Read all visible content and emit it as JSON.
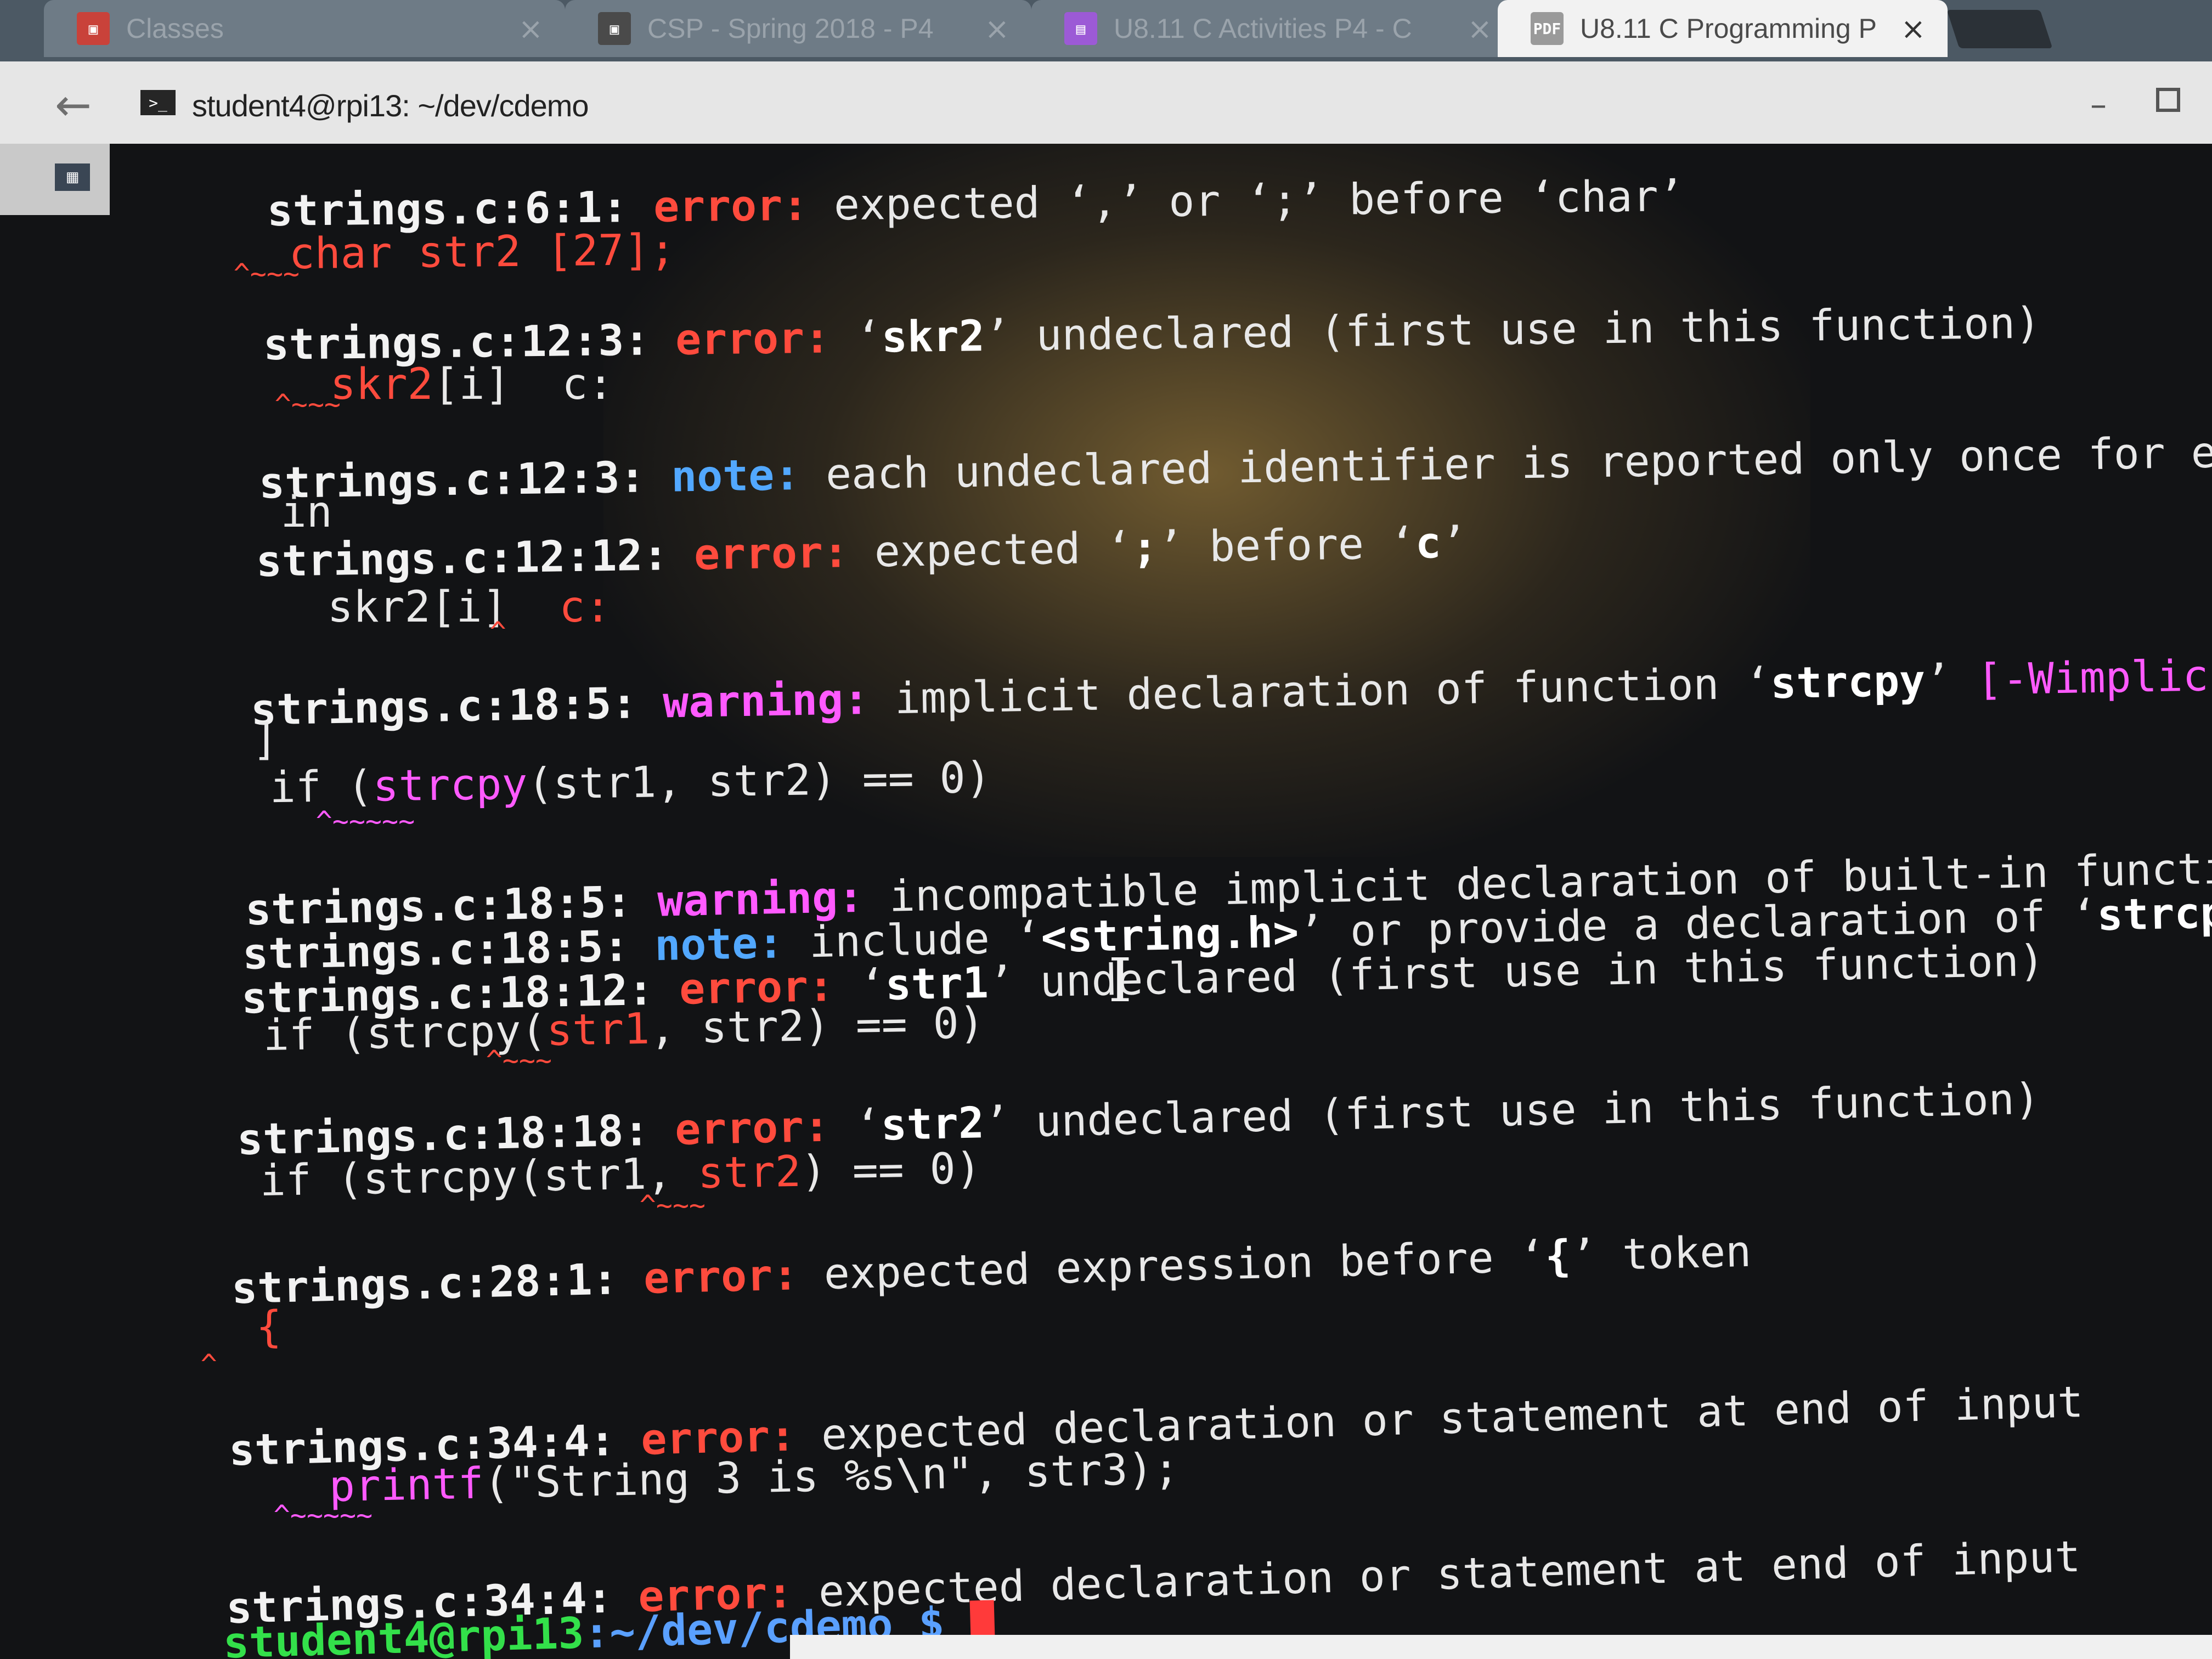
{
  "browser": {
    "tabs": [
      {
        "title": "Classes",
        "favicon": "classroom-icon",
        "favicon_color": "#c9423a",
        "active": false
      },
      {
        "title": "CSP - Spring 2018 - P4",
        "favicon": "classroom-icon",
        "favicon_color": "#4a4a4a",
        "active": false
      },
      {
        "title": "U8.11 C Activities P4 - C",
        "favicon": "slides-icon",
        "favicon_color": "#9c5ad6",
        "active": false
      },
      {
        "title": "U8.11 C Programming P",
        "favicon": "pdf-icon",
        "favicon_color": "#9a9a9a",
        "active": true
      }
    ],
    "tab_close_glyph": "×",
    "pdf_favicon_text": "PDF"
  },
  "window": {
    "title": "student4@rpi13: ~/dev/cdemo",
    "terminal_icon_text": ">_"
  },
  "terminal": {
    "lines": {
      "l1_loc": "strings.c:6:1:",
      "l1_kind": "error:",
      "l1_msg": "expected ‘,’ or ‘;’ before ‘char’",
      "l2_src": "char str2 [27];",
      "l3_caret": "^~~~",
      "l4_loc": "strings.c:12:3:",
      "l4_kind": "error:",
      "l4_msg_a": "‘",
      "l4_ident": "skr2",
      "l4_msg_b": "’ undeclared (first use in this function)",
      "l5_src_a": "skr2",
      "l5_src_b": "[i]  c:",
      "l6_caret": "^~~~",
      "l7_loc": "strings.c:12:3:",
      "l7_kind": "note:",
      "l7_msg": "each undeclared identifier is reported only once for each function it ap",
      "l8_wrap": "in",
      "l9_loc": "strings.c:12:12:",
      "l9_kind": "error:",
      "l9_msg_a": "expected ‘",
      "l9_ident_a": ";",
      "l9_msg_b": "’ before ‘",
      "l9_ident_b": "c",
      "l9_msg_c": "’",
      "l10_src_a": "skr2[i]  ",
      "l10_src_b": "c:",
      "l11_caret": "^",
      "l12_loc": "strings.c:18:5:",
      "l12_kind": "warning:",
      "l12_msg_a": "implicit declaration of function ‘",
      "l12_ident": "strcpy",
      "l12_msg_b": "’ ",
      "l12_flag": "[-Wimplicit-function-decla",
      "l13_wrap": "]",
      "l14_src_a": "if (",
      "l14_src_b": "strcpy",
      "l14_src_c": "(str1, str2) == 0)",
      "l15_caret": "^~~~~~",
      "l16_loc": "strings.c:18:5:",
      "l16_kind": "warning:",
      "l16_msg": "incompatible implicit declaration of built-in function ‘strcpy’",
      "l17_loc": "strings.c:18:5:",
      "l17_kind": "note:",
      "l17_msg_a": "include ‘",
      "l17_ident": "<string.h>",
      "l17_msg_b": "’ or provide a declaration of ‘",
      "l17_ident_b": "strcpy",
      "l17_msg_c": "’",
      "l18_loc": "strings.c:18:12:",
      "l18_kind": "error:",
      "l18_msg_a": "‘",
      "l18_ident": "str1",
      "l18_msg_b": "’ undeclared (first use in this function)",
      "l19_src_a": "if (strcpy(",
      "l19_src_b": "str1",
      "l19_src_c": ", str2) == 0)",
      "l20_caret": "^~~~",
      "l21_loc": "strings.c:18:18:",
      "l21_kind": "error:",
      "l21_msg_a": "‘",
      "l21_ident": "str2",
      "l21_msg_b": "’ undeclared (first use in this function)",
      "l22_src_a": "if (strcpy(str1, ",
      "l22_src_b": "str2",
      "l22_src_c": ") == 0)",
      "l23_caret": "^~~~",
      "l24_loc": "strings.c:28:1:",
      "l24_kind": "error:",
      "l24_msg_a": "expected expression before ‘",
      "l24_ident": "{",
      "l24_msg_b": "’ token",
      "l25_src": "{",
      "l26_caret": "^",
      "l27_loc": "strings.c:34:4:",
      "l27_kind": "error:",
      "l27_msg": "expected declaration or statement at end of input",
      "l28_src_a": "printf",
      "l28_src_b": "(\"String 3 is %s\\n\", str3);",
      "l29_caret": "^~~~~~",
      "l30_loc": "strings.c:34:4:",
      "l30_kind": "error:",
      "l30_msg": "expected declaration or statement at end of input",
      "prompt_user": "student4@rpi13",
      "prompt_path": ":~/dev/cdemo $ "
    }
  },
  "colors": {
    "error": "#ff4b3d",
    "warning": "#ff5aff",
    "note": "#52a8ff",
    "prompt_user": "#33e04a",
    "prompt_path": "#5aa0ff",
    "terminal_bg": "#121315"
  }
}
